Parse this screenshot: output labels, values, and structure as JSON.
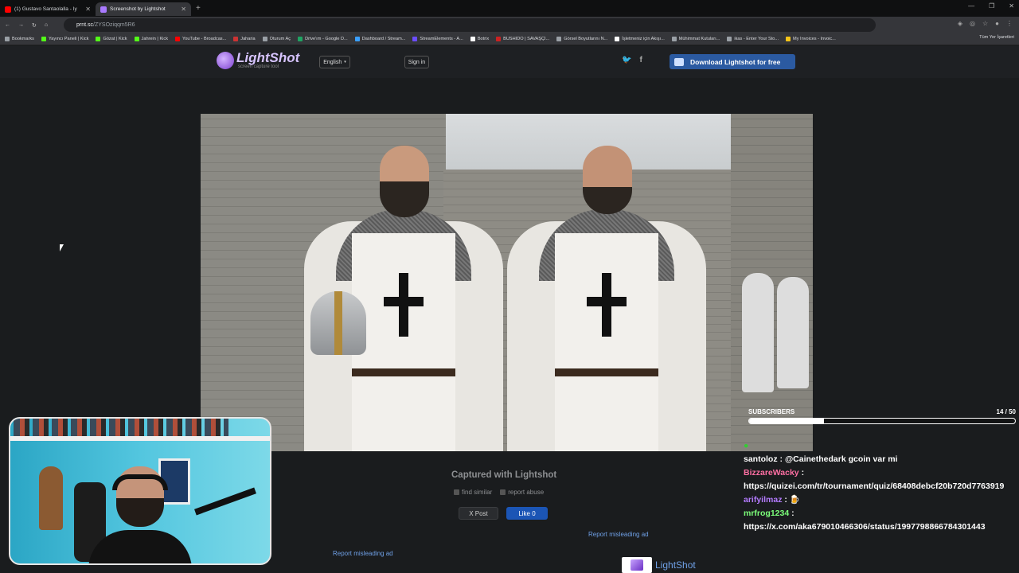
{
  "browser": {
    "tabs": [
      {
        "title": "(1) Gustavo Santaolalla - Iy",
        "fav_color": "#ff0000",
        "active": false
      },
      {
        "title": "Screenshot by Lightshot",
        "fav_color": "#a97aff",
        "active": true
      }
    ],
    "url_host": "prnt.sc",
    "url_path": "/ZYSOziqqm5R6",
    "bookmarks": [
      "Bookmarks",
      "Yayıncı Paneli | Kick",
      "Gözat | Kick",
      "Jahrein | Kick",
      "YouTube - Broadcas...",
      "Jaharia",
      "Oturum Aç",
      "Drive'ım - Google D...",
      "Dashboard / Stream...",
      "StreamElements - A...",
      "Botrix",
      "BUSHIDO | SAVAŞÇI...",
      "Görsel Boyutlarını N...",
      "İşletmeniz için Akışı...",
      "Mühimmat Kutuları...",
      "ikas - Enter Your Sto...",
      "My Invoices - Invoic..."
    ],
    "bookmarks_right": "Tüm Yer İşaretleri"
  },
  "lightshot": {
    "logo_name": "LightShot",
    "logo_tagline": "screen capture tool",
    "language": "English",
    "signin": "Sign in",
    "download_label": "Download Lightshot for free",
    "captured_label": "Captured with Lightshot",
    "find_similar": "find similar",
    "report_abuse": "report abuse",
    "post_label": "X Post",
    "like_label": "Like 0",
    "report_ad_1": "Report misleading ad",
    "report_ad_2": "Report misleading ad",
    "ad_name": "LightShot"
  },
  "overlay": {
    "subs_label": "SUBSCRIBERS",
    "subs_count": "14 / 50",
    "subs_progress": 0.28
  },
  "chat": [
    {
      "user": "",
      "color": "#9b6cff",
      "text": ""
    },
    {
      "user": "santoloz",
      "color": "#ffffff",
      "text": "@Cainethedark gcoin var mi"
    },
    {
      "user": "BizzareWacky",
      "color": "#ff6fa3",
      "text": ""
    },
    {
      "user": "",
      "color": "#ffffff",
      "text": "https://quizei.com/tr/tournament/quiz/68408debcf20b720d7763919"
    },
    {
      "user": "arifyilmaz",
      "color": "#b47bff",
      "text": ""
    },
    {
      "user": "mrfrog1234",
      "color": "#7cff7a",
      "text": ""
    },
    {
      "user": "",
      "color": "#ffffff",
      "text": "https://x.com/aka679010466306/status/1997798866784301443"
    }
  ]
}
